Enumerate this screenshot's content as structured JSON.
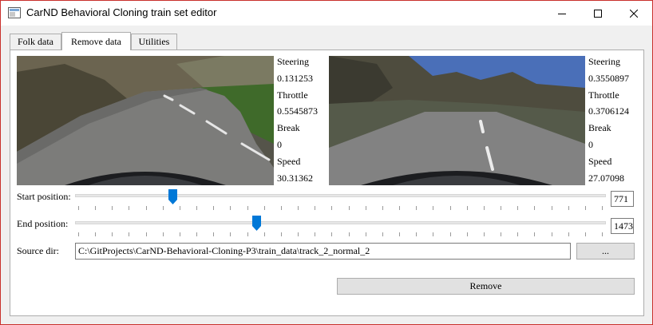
{
  "window": {
    "title": "CarND Behavioral Cloning train set editor",
    "controls": [
      "minimize",
      "maximize",
      "close"
    ]
  },
  "tabs": [
    {
      "label": "Folk data",
      "active": false
    },
    {
      "label": "Remove data",
      "active": true
    },
    {
      "label": "Utilities",
      "active": false
    }
  ],
  "views": [
    {
      "steering_label": "Steering",
      "steering": "0.131253",
      "throttle_label": "Throttle",
      "throttle": "0.5545873",
      "break_label": "Break",
      "break": "0",
      "speed_label": "Speed",
      "speed": "30.31362"
    },
    {
      "steering_label": "Steering",
      "steering": "0.3550897",
      "throttle_label": "Throttle",
      "throttle": "0.3706124",
      "break_label": "Break",
      "break": "0",
      "speed_label": "Speed",
      "speed": "27.07098"
    }
  ],
  "start": {
    "label": "Start position:",
    "value": "771",
    "fraction": 0.18
  },
  "end": {
    "label": "End position:",
    "value": "1473",
    "fraction": 0.34
  },
  "source": {
    "label": "Source dir:",
    "path": "C:\\GitProjects\\CarND-Behavioral-Cloning-P3\\train_data\\track_2_normal_2",
    "browse_label": "..."
  },
  "remove_label": "Remove",
  "colors": {
    "accent": "#0078d7",
    "close_border": "#c9302c"
  },
  "icons": [
    "app-icon",
    "minimize-icon",
    "maximize-icon",
    "close-icon"
  ]
}
